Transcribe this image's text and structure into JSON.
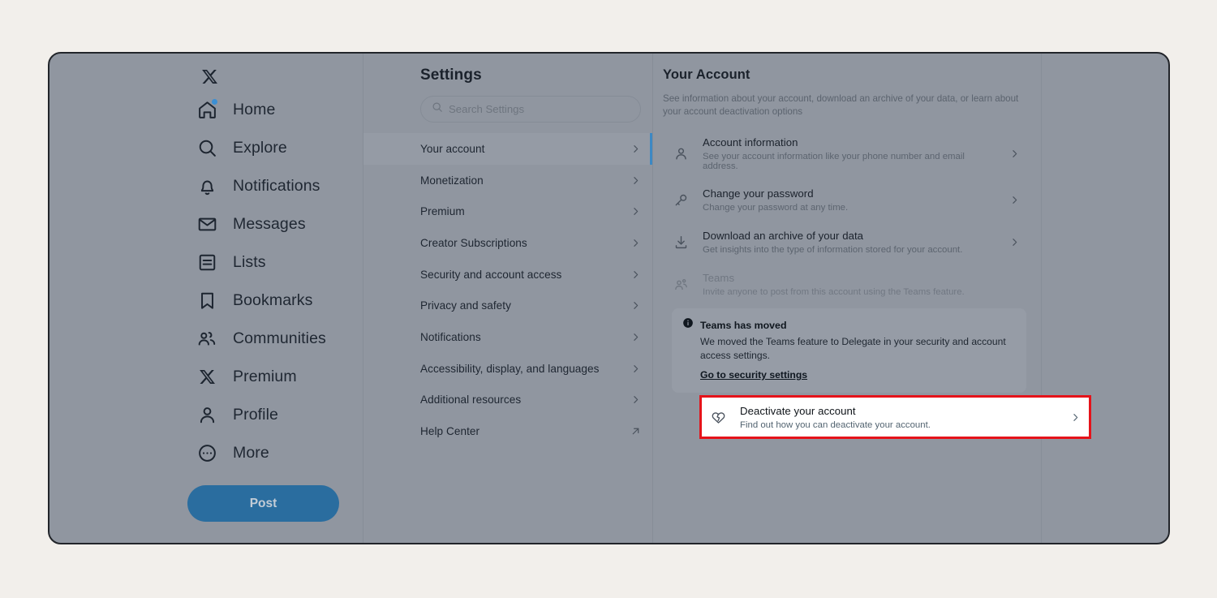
{
  "theme": {
    "page_background": "#f2efeb",
    "window_background": "#9096a0",
    "accent_blue": "#3c88c4",
    "post_button": "#2a6d9f",
    "annotation_red": "#e5131a",
    "highlight_white": "#ffffff"
  },
  "left_nav": {
    "logo": "x-logo",
    "items": [
      {
        "icon": "home-icon",
        "label": "Home",
        "badge": true
      },
      {
        "icon": "search-icon",
        "label": "Explore",
        "badge": false
      },
      {
        "icon": "bell-icon",
        "label": "Notifications",
        "badge": false
      },
      {
        "icon": "envelope-icon",
        "label": "Messages",
        "badge": false
      },
      {
        "icon": "list-icon",
        "label": "Lists",
        "badge": false
      },
      {
        "icon": "bookmark-icon",
        "label": "Bookmarks",
        "badge": false
      },
      {
        "icon": "communities-icon",
        "label": "Communities",
        "badge": false
      },
      {
        "icon": "x-logo-icon",
        "label": "Premium",
        "badge": false
      },
      {
        "icon": "person-icon",
        "label": "Profile",
        "badge": false
      },
      {
        "icon": "more-circle-icon",
        "label": "More",
        "badge": false
      }
    ],
    "post_label": "Post"
  },
  "settings": {
    "title": "Settings",
    "search_placeholder": "Search Settings",
    "search_value": "",
    "search_icon": "search-icon",
    "items": [
      {
        "label": "Your account",
        "icon": "chevron-right-icon",
        "selected": true
      },
      {
        "label": "Monetization",
        "icon": "chevron-right-icon",
        "selected": false
      },
      {
        "label": "Premium",
        "icon": "chevron-right-icon",
        "selected": false
      },
      {
        "label": "Creator Subscriptions",
        "icon": "chevron-right-icon",
        "selected": false
      },
      {
        "label": "Security and account access",
        "icon": "chevron-right-icon",
        "selected": false
      },
      {
        "label": "Privacy and safety",
        "icon": "chevron-right-icon",
        "selected": false
      },
      {
        "label": "Notifications",
        "icon": "chevron-right-icon",
        "selected": false
      },
      {
        "label": "Accessibility, display, and languages",
        "icon": "chevron-right-icon",
        "selected": false
      },
      {
        "label": "Additional resources",
        "icon": "chevron-right-icon",
        "selected": false
      },
      {
        "label": "Help Center",
        "icon": "external-link-icon",
        "selected": false
      }
    ]
  },
  "detail": {
    "title": "Your Account",
    "description": "See information about your account, download an archive of your data, or learn about your account deactivation options",
    "rows": [
      {
        "icon": "person-icon",
        "title": "Account information",
        "subtitle": "See your account information like your phone number and email address.",
        "chevron": "chevron-right-icon",
        "disabled": false
      },
      {
        "icon": "key-icon",
        "title": "Change your password",
        "subtitle": "Change your password at any time.",
        "chevron": "chevron-right-icon",
        "disabled": false
      },
      {
        "icon": "download-icon",
        "title": "Download an archive of your data",
        "subtitle": "Get insights into the type of information stored for your account.",
        "chevron": "chevron-right-icon",
        "disabled": false
      },
      {
        "icon": "teams-icon",
        "title": "Teams",
        "subtitle": "Invite anyone to post from this account using the Teams feature.",
        "chevron": "",
        "disabled": true
      }
    ],
    "banner": {
      "icon": "info-icon",
      "title": "Teams has moved",
      "body": "We moved the Teams feature to Delegate in your security and account access settings.",
      "link": "Go to security settings"
    },
    "deactivate": {
      "icon": "broken-heart-icon",
      "title": "Deactivate your account",
      "subtitle": "Find out how you can deactivate your account.",
      "chevron": "chevron-right-icon"
    }
  }
}
